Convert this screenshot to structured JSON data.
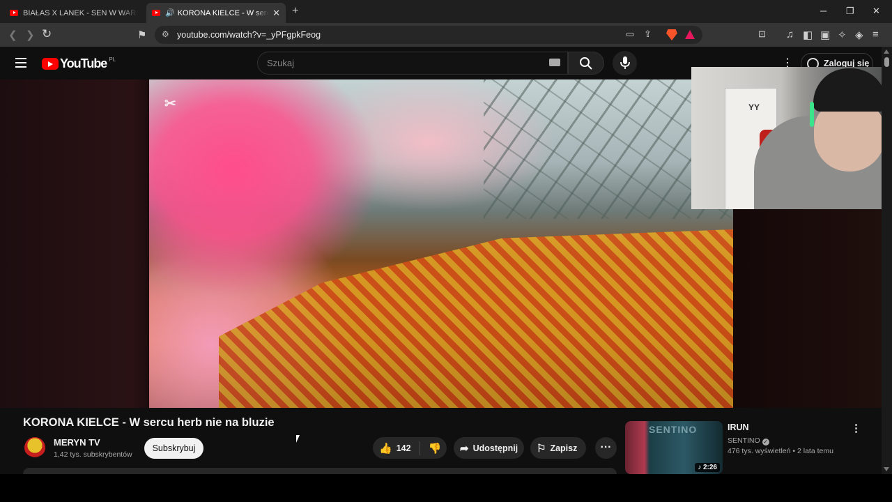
{
  "browser": {
    "tabs": [
      {
        "title": "BIAŁAS X LANEK - SEN W WARSZAWIE",
        "active": false
      },
      {
        "title": "KORONA KIELCE - W sercu herb nie na bluzie",
        "active": true,
        "audio_icon": "speaker-icon"
      }
    ],
    "new_tab": "+",
    "window_controls": {
      "minimize": "─",
      "restore": "❐",
      "close": "✕"
    },
    "url": "youtube.com/watch?v=_yPFgpkFeog",
    "nav": {
      "back": "❮",
      "forward": "❯",
      "reload": "↻",
      "bookmark": "⚑",
      "site_info": "⚙"
    }
  },
  "youtube": {
    "logo_text": "YouTube",
    "country_code": "PL",
    "search_placeholder": "Szukaj",
    "signin_label": "Zaloguj się",
    "video": {
      "title": "KORONA KIELCE - W sercu herb nie na bluzie",
      "channel_name": "MERYN TV",
      "channel_subs": "1,42 tys. subskrybentów",
      "subscribe_label": "Subskrybuj",
      "like_count": "142",
      "share_label": "Udostępnij",
      "save_label": "Zapisz",
      "overlay_logo": "✂"
    },
    "recommended": [
      {
        "title": "IRUN",
        "channel": "SENTINO",
        "views": "476 tys. wyświetleń",
        "age": "2 lata temu",
        "duration": "♪ 2:26",
        "thumb_text": "SENTINO"
      }
    ]
  },
  "webcam": {
    "door_text": "YY"
  }
}
